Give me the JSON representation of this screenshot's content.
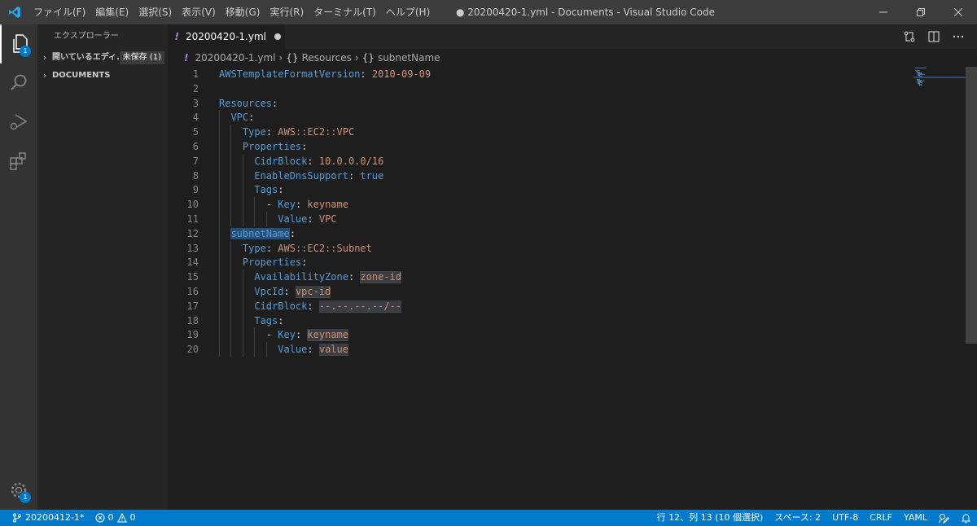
{
  "window": {
    "title": "● 20200420-1.yml - Documents - Visual Studio Code",
    "menu": [
      "ファイル(F)",
      "編集(E)",
      "選択(S)",
      "表示(V)",
      "移動(G)",
      "実行(R)",
      "ターミナル(T)",
      "ヘルプ(H)"
    ]
  },
  "activity": {
    "explorer_badge": "1",
    "settings_badge": "1"
  },
  "sidebar": {
    "title": "エクスプローラー",
    "open_editors_label": "開いているエディ...",
    "open_editors_badge": "未保存 (1)",
    "folder_label": "DOCUMENTS"
  },
  "tab": {
    "label": "20200420-1.yml",
    "modified_marker": "!"
  },
  "breadcrumb": {
    "file": "20200420-1.yml",
    "level1": "Resources",
    "level2": "subnetName",
    "braces": "{}"
  },
  "editor": {
    "lines": [
      {
        "num": "1",
        "indent": "",
        "key": "AWSTemplateFormatVersion",
        "value": "2010-09-09",
        "vclass": "s"
      },
      {
        "num": "2",
        "indent": "",
        "key": "",
        "value": "",
        "vclass": ""
      },
      {
        "num": "3",
        "indent": "",
        "key": "Resources",
        "value": "",
        "vclass": ""
      },
      {
        "num": "4",
        "indent": "  ",
        "key": "VPC",
        "value": "",
        "vclass": ""
      },
      {
        "num": "5",
        "indent": "    ",
        "key": "Type",
        "value": "AWS::EC2::VPC",
        "vclass": "s"
      },
      {
        "num": "6",
        "indent": "    ",
        "key": "Properties",
        "value": "",
        "vclass": ""
      },
      {
        "num": "7",
        "indent": "      ",
        "key": "CidrBlock",
        "value": "10.0.0.0/16",
        "vclass": "s"
      },
      {
        "num": "8",
        "indent": "      ",
        "key": "EnableDnsSupport",
        "value": "true",
        "vclass": "b"
      },
      {
        "num": "9",
        "indent": "      ",
        "key": "Tags",
        "value": "",
        "vclass": ""
      },
      {
        "num": "10",
        "indent": "        ",
        "dash": "- ",
        "key": "Key",
        "value": "keyname",
        "vclass": "s"
      },
      {
        "num": "11",
        "indent": "          ",
        "key": "Value",
        "value": "VPC",
        "vclass": "s"
      },
      {
        "num": "12",
        "indent": "  ",
        "key": "subnetName",
        "value": "",
        "vclass": "",
        "selected": true
      },
      {
        "num": "13",
        "indent": "    ",
        "key": "Type",
        "value": "AWS::EC2::Subnet",
        "vclass": "s"
      },
      {
        "num": "14",
        "indent": "    ",
        "key": "Properties",
        "value": "",
        "vclass": ""
      },
      {
        "num": "15",
        "indent": "      ",
        "key": "AvailabilityZone",
        "value": "zone-id",
        "vclass": "s",
        "placeholder": true
      },
      {
        "num": "16",
        "indent": "      ",
        "key": "VpcId",
        "value": "vpc-id",
        "vclass": "s",
        "placeholder": true
      },
      {
        "num": "17",
        "indent": "      ",
        "key": "CidrBlock",
        "value": "--.--.--.--/--",
        "vclass": "s",
        "placeholder": true
      },
      {
        "num": "18",
        "indent": "      ",
        "key": "Tags",
        "value": "",
        "vclass": ""
      },
      {
        "num": "19",
        "indent": "        ",
        "dash": "- ",
        "key": "Key",
        "value": "keyname",
        "vclass": "s",
        "placeholder": true
      },
      {
        "num": "20",
        "indent": "          ",
        "key": "Value",
        "value": "value",
        "vclass": "s",
        "placeholder": true
      }
    ]
  },
  "status": {
    "branch": "20200412-1*",
    "errors": "0",
    "warnings": "0",
    "position": "行 12、列 13 (10 個選択)",
    "spaces": "スペース: 2",
    "encoding": "UTF-8",
    "eol": "CRLF",
    "language": "YAML"
  },
  "colors": {
    "accent": "#007acc",
    "key": "#569cd6",
    "string": "#ce9178",
    "titlebar": "#3c3c3c"
  }
}
